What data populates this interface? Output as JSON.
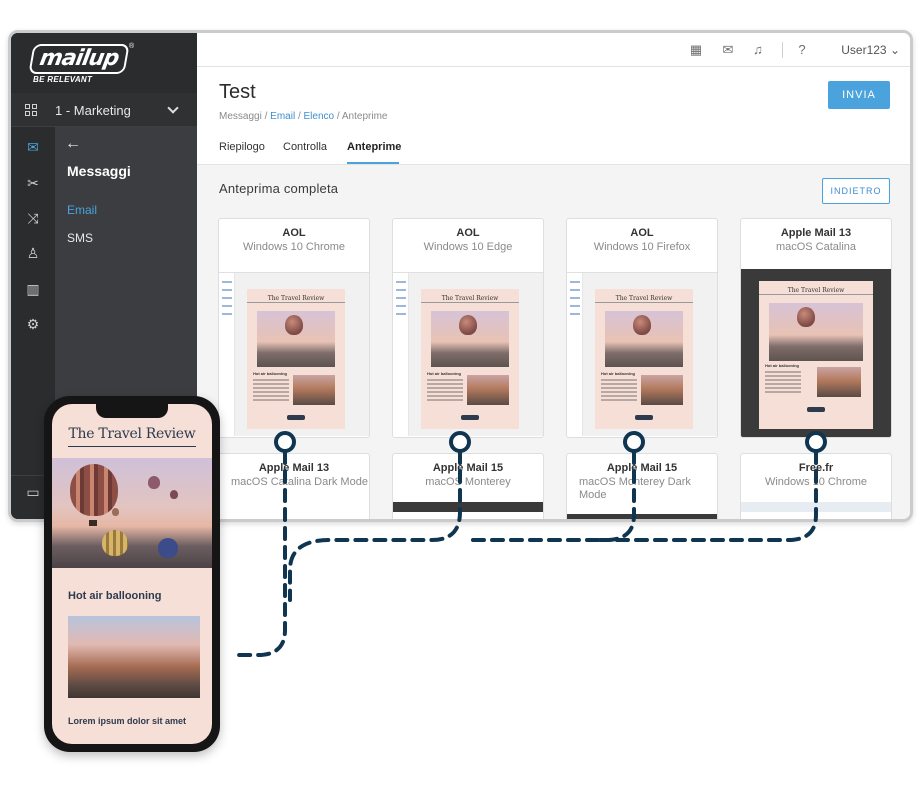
{
  "brand": {
    "logo_text": "mailup",
    "reg_mark": "®",
    "tagline": "BE RELEVANT"
  },
  "account": {
    "label": "1 - Marketing"
  },
  "sidebar": {
    "rail_icons": [
      "envelope-icon",
      "tools-icon",
      "shuffle-icon",
      "user-icon",
      "bar-chart-icon",
      "gear-icon"
    ],
    "back_symbol": "←",
    "section_title": "Messaggi",
    "items": [
      {
        "label": "Email",
        "active": true
      },
      {
        "label": "SMS",
        "active": false
      }
    ]
  },
  "topbar": {
    "icons": [
      "calendar-icon",
      "mail-outgoing-icon",
      "bell-icon",
      "help-icon"
    ],
    "user": "User123"
  },
  "header": {
    "title": "Test",
    "breadcrumb": [
      "Messaggi",
      "Email",
      "Elenco",
      "Anteprime"
    ],
    "breadcrumb_sep": " / ",
    "send_label": "INVIA",
    "tabs": [
      {
        "label": "Riepilogo",
        "active": false
      },
      {
        "label": "Controlla",
        "active": false
      },
      {
        "label": "Anteprime",
        "active": true
      }
    ]
  },
  "preview": {
    "section_title": "Anteprima completa",
    "back_label": "INDIETRO",
    "cards": [
      {
        "client": "AOL",
        "env": "Windows 10 Chrome"
      },
      {
        "client": "AOL",
        "env": "Windows 10 Edge"
      },
      {
        "client": "AOL",
        "env": "Windows 10 Firefox"
      },
      {
        "client": "Apple Mail 13",
        "env": "macOS Catalina"
      },
      {
        "client": "Apple Mail 13",
        "env": "macOS Catalina Dark Mode"
      },
      {
        "client": "Apple Mail 15",
        "env": "macOS Monterey"
      },
      {
        "client": "Apple Mail 15",
        "env": "macOS Monterey Dark Mode"
      },
      {
        "client": "Free.fr",
        "env": "Windows 10 Chrome"
      }
    ],
    "thumb_masthead": "The Travel Review",
    "thumb_heading": "Hot air ballooning",
    "thumb_button": "BOOK"
  },
  "phone": {
    "masthead": "The Travel Review",
    "heading": "Hot air ballooning",
    "subheading": "Lorem ipsum dolor sit amet"
  },
  "colors": {
    "accent": "#4aa3dc",
    "sidebar_dark": "#2f3133",
    "email_bg": "#f5dfd6",
    "connector": "#0f3550"
  }
}
